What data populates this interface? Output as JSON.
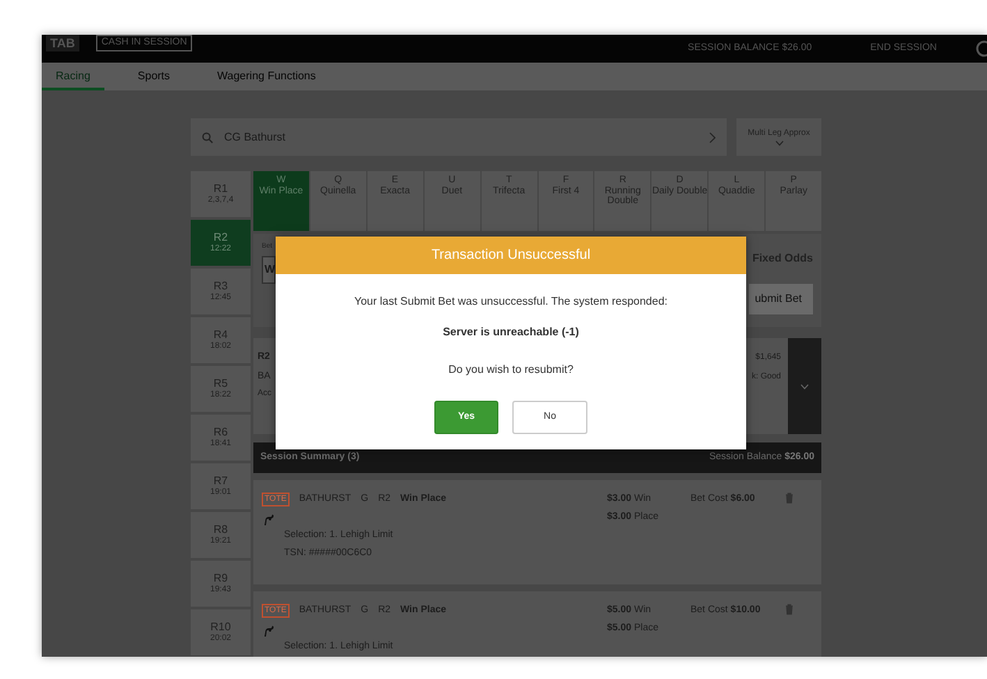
{
  "header": {
    "logo": "TAB",
    "session_label": "CASH IN SESSION",
    "balance": "SESSION BALANCE $26.00",
    "end_session": "END SESSION"
  },
  "nav_tabs": [
    {
      "label": "Racing",
      "selected": true
    },
    {
      "label": "Sports",
      "selected": false
    },
    {
      "label": "Wagering Functions",
      "selected": false
    }
  ],
  "search": {
    "value": "CG Bathurst"
  },
  "multi_leg_button": "Multi Leg Approx",
  "races": [
    {
      "number": "R1",
      "time": "2,3,7,4",
      "selected": false
    },
    {
      "number": "R2",
      "time": "12:22",
      "selected": true
    },
    {
      "number": "R3",
      "time": "12:45",
      "selected": false
    },
    {
      "number": "R4",
      "time": "18:02",
      "selected": false
    },
    {
      "number": "R5",
      "time": "18:22",
      "selected": false
    },
    {
      "number": "R6",
      "time": "18:41",
      "selected": false
    },
    {
      "number": "R7",
      "time": "19:01",
      "selected": false
    },
    {
      "number": "R8",
      "time": "19:21",
      "selected": false
    },
    {
      "number": "R9",
      "time": "19:43",
      "selected": false
    },
    {
      "number": "R10",
      "time": "20:02",
      "selected": false
    }
  ],
  "bet_types": [
    {
      "code": "W",
      "label": "Win Place",
      "selected": true
    },
    {
      "code": "Q",
      "label": "Quinella",
      "selected": false
    },
    {
      "code": "E",
      "label": "Exacta",
      "selected": false
    },
    {
      "code": "U",
      "label": "Duet",
      "selected": false
    },
    {
      "code": "T",
      "label": "Trifecta",
      "selected": false
    },
    {
      "code": "F",
      "label": "First 4",
      "selected": false
    },
    {
      "code": "R",
      "label": "Running Double",
      "selected": false
    },
    {
      "code": "D",
      "label": "Daily Double",
      "selected": false
    },
    {
      "code": "L",
      "label": "Quaddie",
      "selected": false
    },
    {
      "code": "P",
      "label": "Parlay",
      "selected": false
    }
  ],
  "bet_panel": {
    "label": "Bet",
    "select_value": "W",
    "odds_label": "Fixed Odds",
    "submit_button": "ubmit Bet"
  },
  "race_card": {
    "left_lines": [
      "R2",
      "BA",
      "Acc"
    ],
    "right_lines": [
      "$1,645",
      "k: Good"
    ]
  },
  "session_summary": {
    "title": "Session Summary (3)",
    "balance": "Session Balance **$26.00**"
  },
  "bets": [
    {
      "badge": "TOTE",
      "venue": "BATHURST",
      "code": "G",
      "race": "R2",
      "bet": "Win Place",
      "details": [
        "Selection: 1. Lehigh Limit",
        "TSN: #####00C6C0"
      ],
      "amounts": [
        "**$3.00** Win",
        "**$3.00** Place"
      ],
      "cost": "Bet Cost **$6.00**"
    },
    {
      "badge": "TOTE",
      "venue": "BATHURST",
      "code": "G",
      "race": "R2",
      "bet": "Win Place",
      "details": [
        "Selection: 1. Lehigh Limit"
      ],
      "amounts": [
        "**$5.00** Win",
        "**$5.00** Place"
      ],
      "cost": "Bet Cost **$10.00**"
    }
  ],
  "dialog": {
    "title": "Transaction Unsuccessful",
    "message": "Your last Submit Bet was unsuccessful. The system responded:",
    "error": "Server is unreachable (-1)",
    "question": "Do you wish to resubmit?",
    "buttons": [
      {
        "label": "Yes",
        "primary": true
      },
      {
        "label": "No",
        "primary": false
      }
    ]
  }
}
